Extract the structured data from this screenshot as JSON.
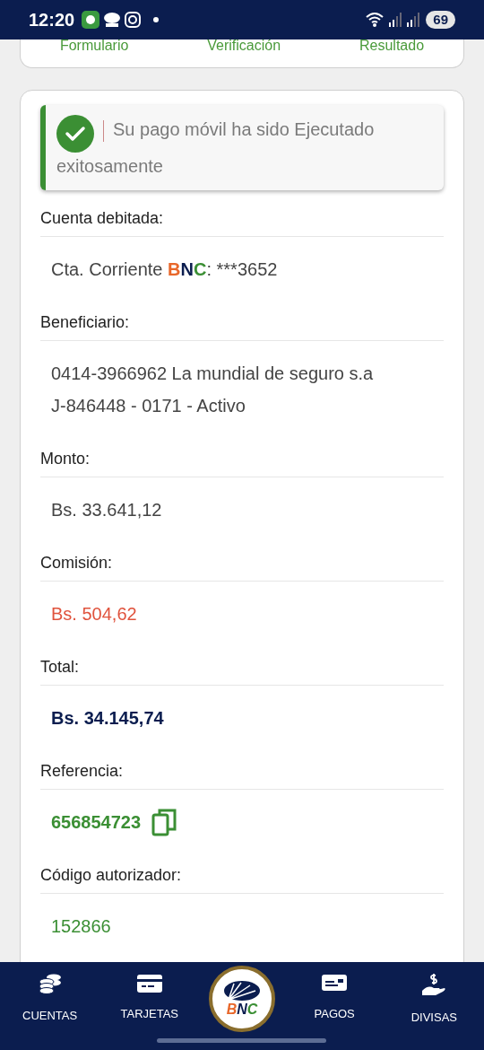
{
  "status_bar": {
    "time": "12:20",
    "battery": "69"
  },
  "steps": [
    "Formulario",
    "Verificación",
    "Resultado"
  ],
  "alert": {
    "message": "Su pago móvil ha sido Ejecutado exitosamente"
  },
  "fields": [
    {
      "label": "Cuenta debitada:",
      "kind": "account",
      "prefix": "Cta. Corriente ",
      "brand": "BNC",
      "suffix": ": ***3652"
    },
    {
      "label": "Beneficiario:",
      "kind": "plain",
      "lines": [
        "0414-3966962 La mundial de seguro s.a",
        "J-846448 - 0171 - Activo"
      ]
    },
    {
      "label": "Monto:",
      "kind": "plain",
      "lines": [
        "Bs. 33.641,12"
      ]
    },
    {
      "label": "Comisión:",
      "kind": "red",
      "lines": [
        "Bs. 504,62"
      ]
    },
    {
      "label": "Total:",
      "kind": "total",
      "lines": [
        "Bs. 34.145,74"
      ]
    },
    {
      "label": "Referencia:",
      "kind": "reference",
      "lines": [
        "656854723"
      ]
    },
    {
      "label": "Código autorizador:",
      "kind": "green",
      "lines": [
        "152866"
      ]
    }
  ],
  "nav": [
    {
      "label": "CUENTAS",
      "kind": "coins"
    },
    {
      "label": "TARJETAS",
      "kind": "card"
    },
    {
      "label": "BNC",
      "kind": "logo"
    },
    {
      "label": "PAGOS",
      "kind": "payment"
    },
    {
      "label": "DIVISAS",
      "kind": "hand"
    }
  ]
}
